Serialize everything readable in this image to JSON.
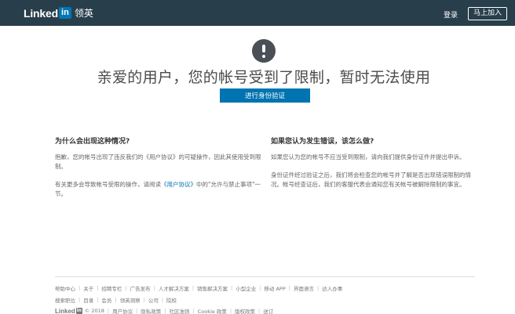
{
  "header": {
    "logo_word": "Linked",
    "logo_box": "in",
    "logo_cn": "领英",
    "signin_label": "登录",
    "join_label": "马上加入"
  },
  "main": {
    "alert_icon": "alert-circle-icon",
    "headline": "亲爱的用户，您的帐号受到了限制，暂时无法使用",
    "verify_button": "进行身份验证"
  },
  "left_section": {
    "title": "为什么会出现这种情况?",
    "para1": "抱歉，您的帐号出现了违反我们的《用户协议》的可疑操作，因此其使用受到限制。",
    "para2_pre": "有关更多会导致帐号受限的操作，请阅读",
    "para2_link": "《用户协议》",
    "para2_post": "中的\"允许与禁止事项\"一节。"
  },
  "right_section": {
    "title": "如果您认为发生错误，该怎么做?",
    "para1": "如果您认为您的帐号不应当受到限制，请向我们提供身份证件并提出申诉。",
    "para2": "身份证件经过验证之后，我们将会检查您的帐号并了解是否出现错误限制的情况。帐号经查证后，我们的客服代表会通知您有关帐号被解除限制的事宜。"
  },
  "footer": {
    "row1": [
      "帮助中心",
      "关于",
      "招聘专栏",
      "广告发布",
      "人才解决方案",
      "销售解决方案",
      "小型企业",
      "移动 APP",
      "界面语言",
      "达人办事"
    ],
    "row2": [
      "搜索职位",
      "目录",
      "会员",
      "领英洞察",
      "公司",
      "院校"
    ],
    "row3_logo_word": "Linked",
    "row3_logo_box": "in",
    "copyright": "© 2018",
    "row3": [
      "用户协议",
      "隐私政策",
      "社区准则",
      "Cookie 政策",
      "版权政策",
      "送订"
    ]
  },
  "colors": {
    "topbar": "#283e4a",
    "brand_blue": "#0073b1",
    "alert_icon": "#4b4f56"
  }
}
